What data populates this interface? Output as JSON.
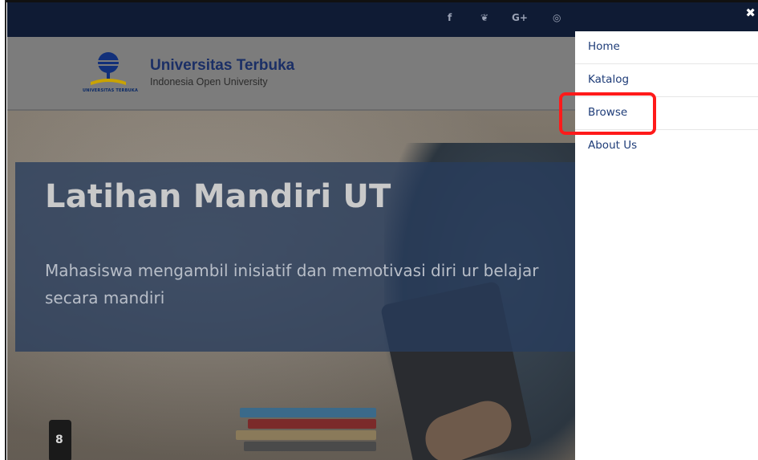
{
  "topbar": {
    "social": [
      {
        "name": "facebook-icon",
        "glyph": "f"
      },
      {
        "name": "twitter-icon",
        "glyph": "❦"
      },
      {
        "name": "google-plus-icon",
        "glyph": "G+"
      },
      {
        "name": "instagram-icon",
        "glyph": "◎"
      }
    ]
  },
  "header": {
    "logo_caption": "UNIVERSITAS TERBUKA",
    "brand_title": "Universitas Terbuka",
    "brand_subtitle": "Indonesia Open University"
  },
  "hero": {
    "title": "Latihan Mandiri UT",
    "text": "Mahasiswa mengambil inisiatif dan memotivasi diri ur belajar secara mandiri",
    "bottle_label": "8"
  },
  "menu": {
    "close_icon": "✖",
    "items": [
      {
        "label": "Home"
      },
      {
        "label": "Katalog"
      },
      {
        "label": "Browse"
      },
      {
        "label": "About Us"
      }
    ]
  },
  "colors": {
    "navy": "#0f1b34",
    "link": "#1e3c78",
    "highlight": "#ff1a1a"
  }
}
